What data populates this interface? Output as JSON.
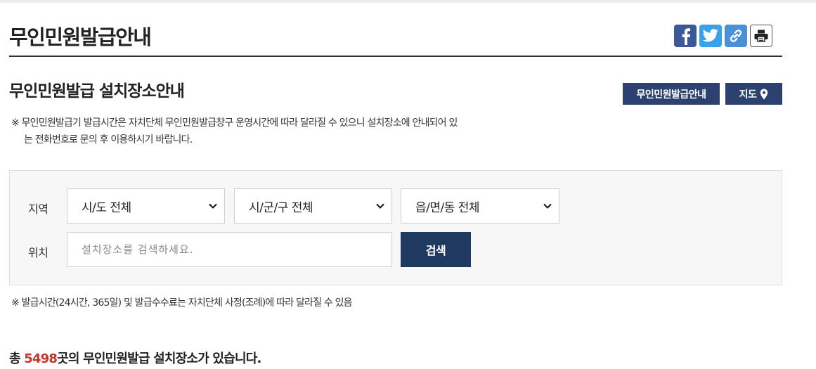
{
  "page": {
    "title": "무인민원발급안내"
  },
  "share": [
    {
      "name": "facebook",
      "icon": "facebook-icon"
    },
    {
      "name": "twitter",
      "icon": "twitter-icon"
    },
    {
      "name": "link",
      "icon": "link-icon"
    },
    {
      "name": "print",
      "icon": "print-icon"
    }
  ],
  "section": {
    "title": "무인민원발급 설치장소안내",
    "guide_button": "무인민원발급안내",
    "map_button": "지도",
    "map_icon": "map-pin-icon"
  },
  "notice": {
    "line1": "※ 무인민원발급기 발급시간은 자치단체 무인민원발급창구 운영시간에 따라 달라질 수 있으니 설치장소에 안내되어 있",
    "line2": "는 전화번호로 문의 후 이용하시기 바랍니다."
  },
  "search": {
    "region_label": "지역",
    "location_label": "위치",
    "sido": "시/도 전체",
    "sigungu": "시/군/구 전체",
    "eupmyeondong": "읍/면/동 전체",
    "placeholder": "설치장소를 검색하세요.",
    "button": "검색"
  },
  "notice2": "※ 발급시간(24시간, 365일) 및 발급수수료는 자치단체 사정(조례)에 따라 달라질 수 있음",
  "summary": {
    "prefix": "총 ",
    "count": "5498",
    "suffix": "곳의 무인민원발급 설치장소가 있습니다."
  },
  "colors": {
    "accent": "#2c4170",
    "search_button": "#1f3a60",
    "count": "#c0392b",
    "facebook": "#3b5998",
    "twitter": "#3aa0e8",
    "link": "#4a90d9"
  }
}
